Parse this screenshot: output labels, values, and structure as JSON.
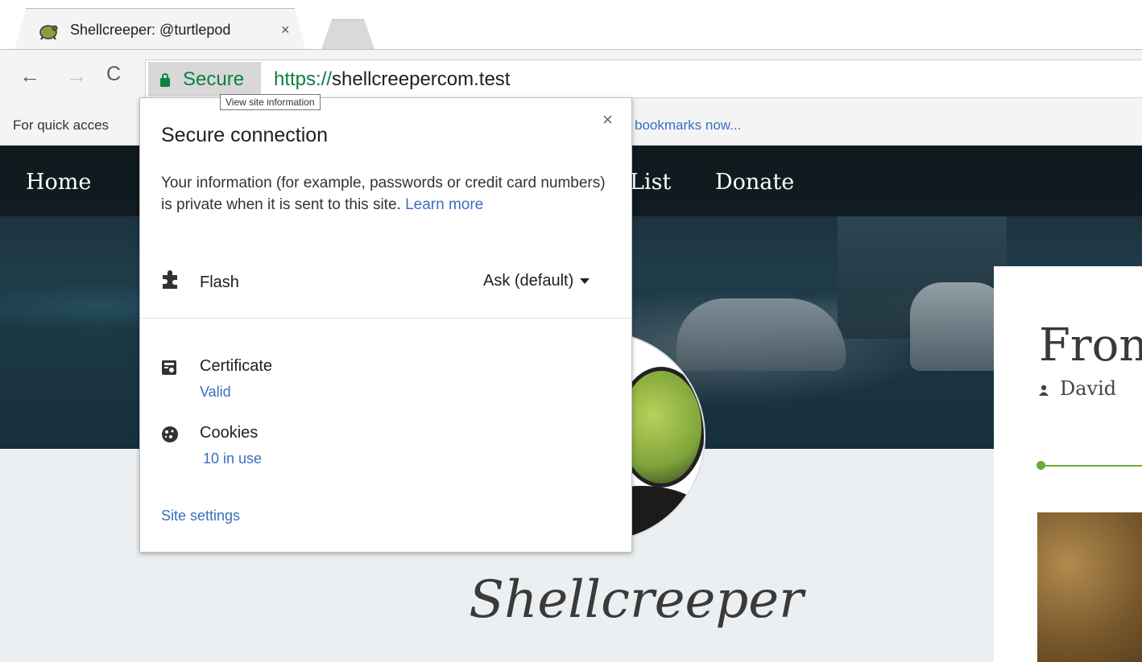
{
  "tab": {
    "title": "Shellcreeper: @turtlepod",
    "close": "×"
  },
  "toolbar": {
    "back": "←",
    "forward": "→",
    "reload": "C",
    "secure_label": "Secure",
    "url_scheme": "https://",
    "url_host": "shellcreepercom.test",
    "tooltip": "View site information"
  },
  "bookmarks_bar": {
    "prompt": "For quick acces",
    "link": "bookmarks now..."
  },
  "site": {
    "nav": [
      "Home",
      "List",
      "Donate"
    ],
    "brand": "Shellcreeper",
    "post": {
      "title": "Fron",
      "author": "David"
    }
  },
  "page_info": {
    "title": "Secure connection",
    "close": "×",
    "description": "Your information (for example, passwords or credit card numbers) is private when it is sent to this site.",
    "learn_more": "Learn more",
    "permission": {
      "label": "Flash",
      "value": "Ask (default)"
    },
    "certificate": {
      "label": "Certificate",
      "value": "Valid"
    },
    "cookies": {
      "label": "Cookies",
      "value": "10 in use"
    },
    "site_settings": "Site settings"
  },
  "icons": {
    "lock": "lock-icon",
    "puzzle": "puzzle-piece-icon",
    "certificate": "certificate-icon",
    "cookie": "cookie-icon",
    "person": "person-icon"
  },
  "colors": {
    "secure_green": "#0b8043",
    "link_blue": "#3b6fc1",
    "accent_green": "#6bab36"
  }
}
